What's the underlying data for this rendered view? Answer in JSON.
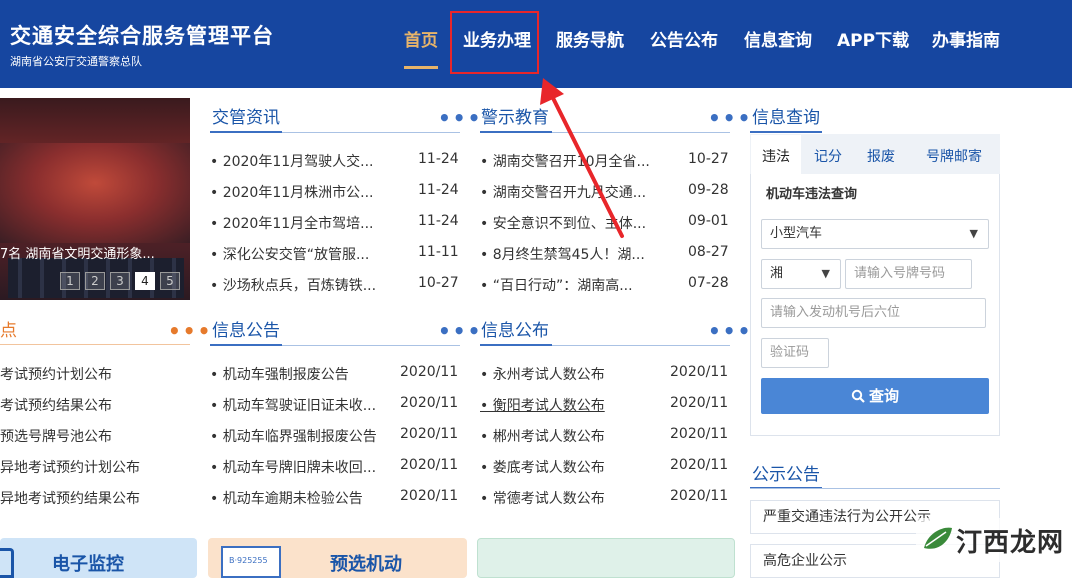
{
  "header": {
    "title": "交通安全综合服务管理平台",
    "subtitle": "湖南省公安厅交通警察总队",
    "nav": [
      "首页",
      "业务办理",
      "服务导航",
      "公告公布",
      "信息查询",
      "APP下载",
      "办事指南"
    ],
    "active_index": 0
  },
  "carousel": {
    "caption": "7名 湖南省文明交通形象...",
    "pages": [
      "1",
      "2",
      "3",
      "4",
      "5"
    ],
    "active_page": 4
  },
  "left_section": {
    "title": "点",
    "more": "•••",
    "items": [
      "考试预约计划公布",
      "考试预约结果公布",
      "预选号牌号池公布",
      "异地考试预约计划公布",
      "异地考试预约结果公布"
    ]
  },
  "news": {
    "title": "交管资讯",
    "more": "•••",
    "items": [
      {
        "text": "• 2020年11月驾驶人交...",
        "date": "11-24"
      },
      {
        "text": "• 2020年11月株洲市公...",
        "date": "11-24"
      },
      {
        "text": "• 2020年11月全市驾培...",
        "date": "11-24"
      },
      {
        "text": "• 深化公安交管“放管服...",
        "date": "11-11"
      },
      {
        "text": "• 沙场秋点兵，百炼铸铁...",
        "date": "10-27"
      }
    ]
  },
  "warning": {
    "title": "警示教育",
    "more": "•••",
    "items": [
      {
        "text": "• 湖南交警召开10月全省...",
        "date": "10-27"
      },
      {
        "text": "• 湖南交警召开九月交通...",
        "date": "09-28"
      },
      {
        "text": "• 安全意识不到位、主体...",
        "date": "09-01"
      },
      {
        "text": "• 8月终生禁驾45人！湖...",
        "date": "08-27"
      },
      {
        "text": "• “百日行动”：湖南高...",
        "date": "07-28"
      }
    ]
  },
  "info_notice": {
    "title": "信息公告",
    "more": "•••",
    "items": [
      {
        "text": "• 机动车强制报废公告",
        "date": "2020/11"
      },
      {
        "text": "• 机动车驾驶证旧证未收...",
        "date": "2020/11"
      },
      {
        "text": "• 机动车临界强制报废公告",
        "date": "2020/11"
      },
      {
        "text": "• 机动车号牌旧牌未收回...",
        "date": "2020/11"
      },
      {
        "text": "• 机动车逾期未检验公告",
        "date": "2020/11"
      }
    ]
  },
  "info_publish": {
    "title": "信息公布",
    "more": "•••",
    "items": [
      {
        "text": "• 永州考试人数公布",
        "date": "2020/11"
      },
      {
        "text": "• 衡阳考试人数公布",
        "date": "2020/11"
      },
      {
        "text": "• 郴州考试人数公布",
        "date": "2020/11"
      },
      {
        "text": "• 娄底考试人数公布",
        "date": "2020/11"
      },
      {
        "text": "• 常德考试人数公布",
        "date": "2020/11"
      }
    ]
  },
  "query": {
    "title": "信息查询",
    "tabs": [
      "违法",
      "记分",
      "报废",
      "号牌邮寄"
    ],
    "active_tab": 0,
    "subtitle": "机动车违法查询",
    "vehicle_type": "小型汽车",
    "province": "湘",
    "plate_placeholder": "请输入号牌号码",
    "engine_placeholder": "请输入发动机号后六位",
    "captcha_placeholder": "验证码",
    "button": "查询"
  },
  "notices": {
    "title": "公示公告",
    "items": [
      "严重交通违法行为公开公示",
      "高危企业公示"
    ]
  },
  "tiles": {
    "monitor": "电子监控",
    "preselect": "预选机动",
    "preselect_plate": "B·925255"
  },
  "watermark": "汀西龙网",
  "colors": {
    "header_bg": "#1646a0",
    "accent_blue": "#1a55a8",
    "accent_orange": "#e67a2c",
    "active_nav": "#e7b46a",
    "highlight_red": "#e8262a",
    "button_blue": "#4a86d6"
  }
}
